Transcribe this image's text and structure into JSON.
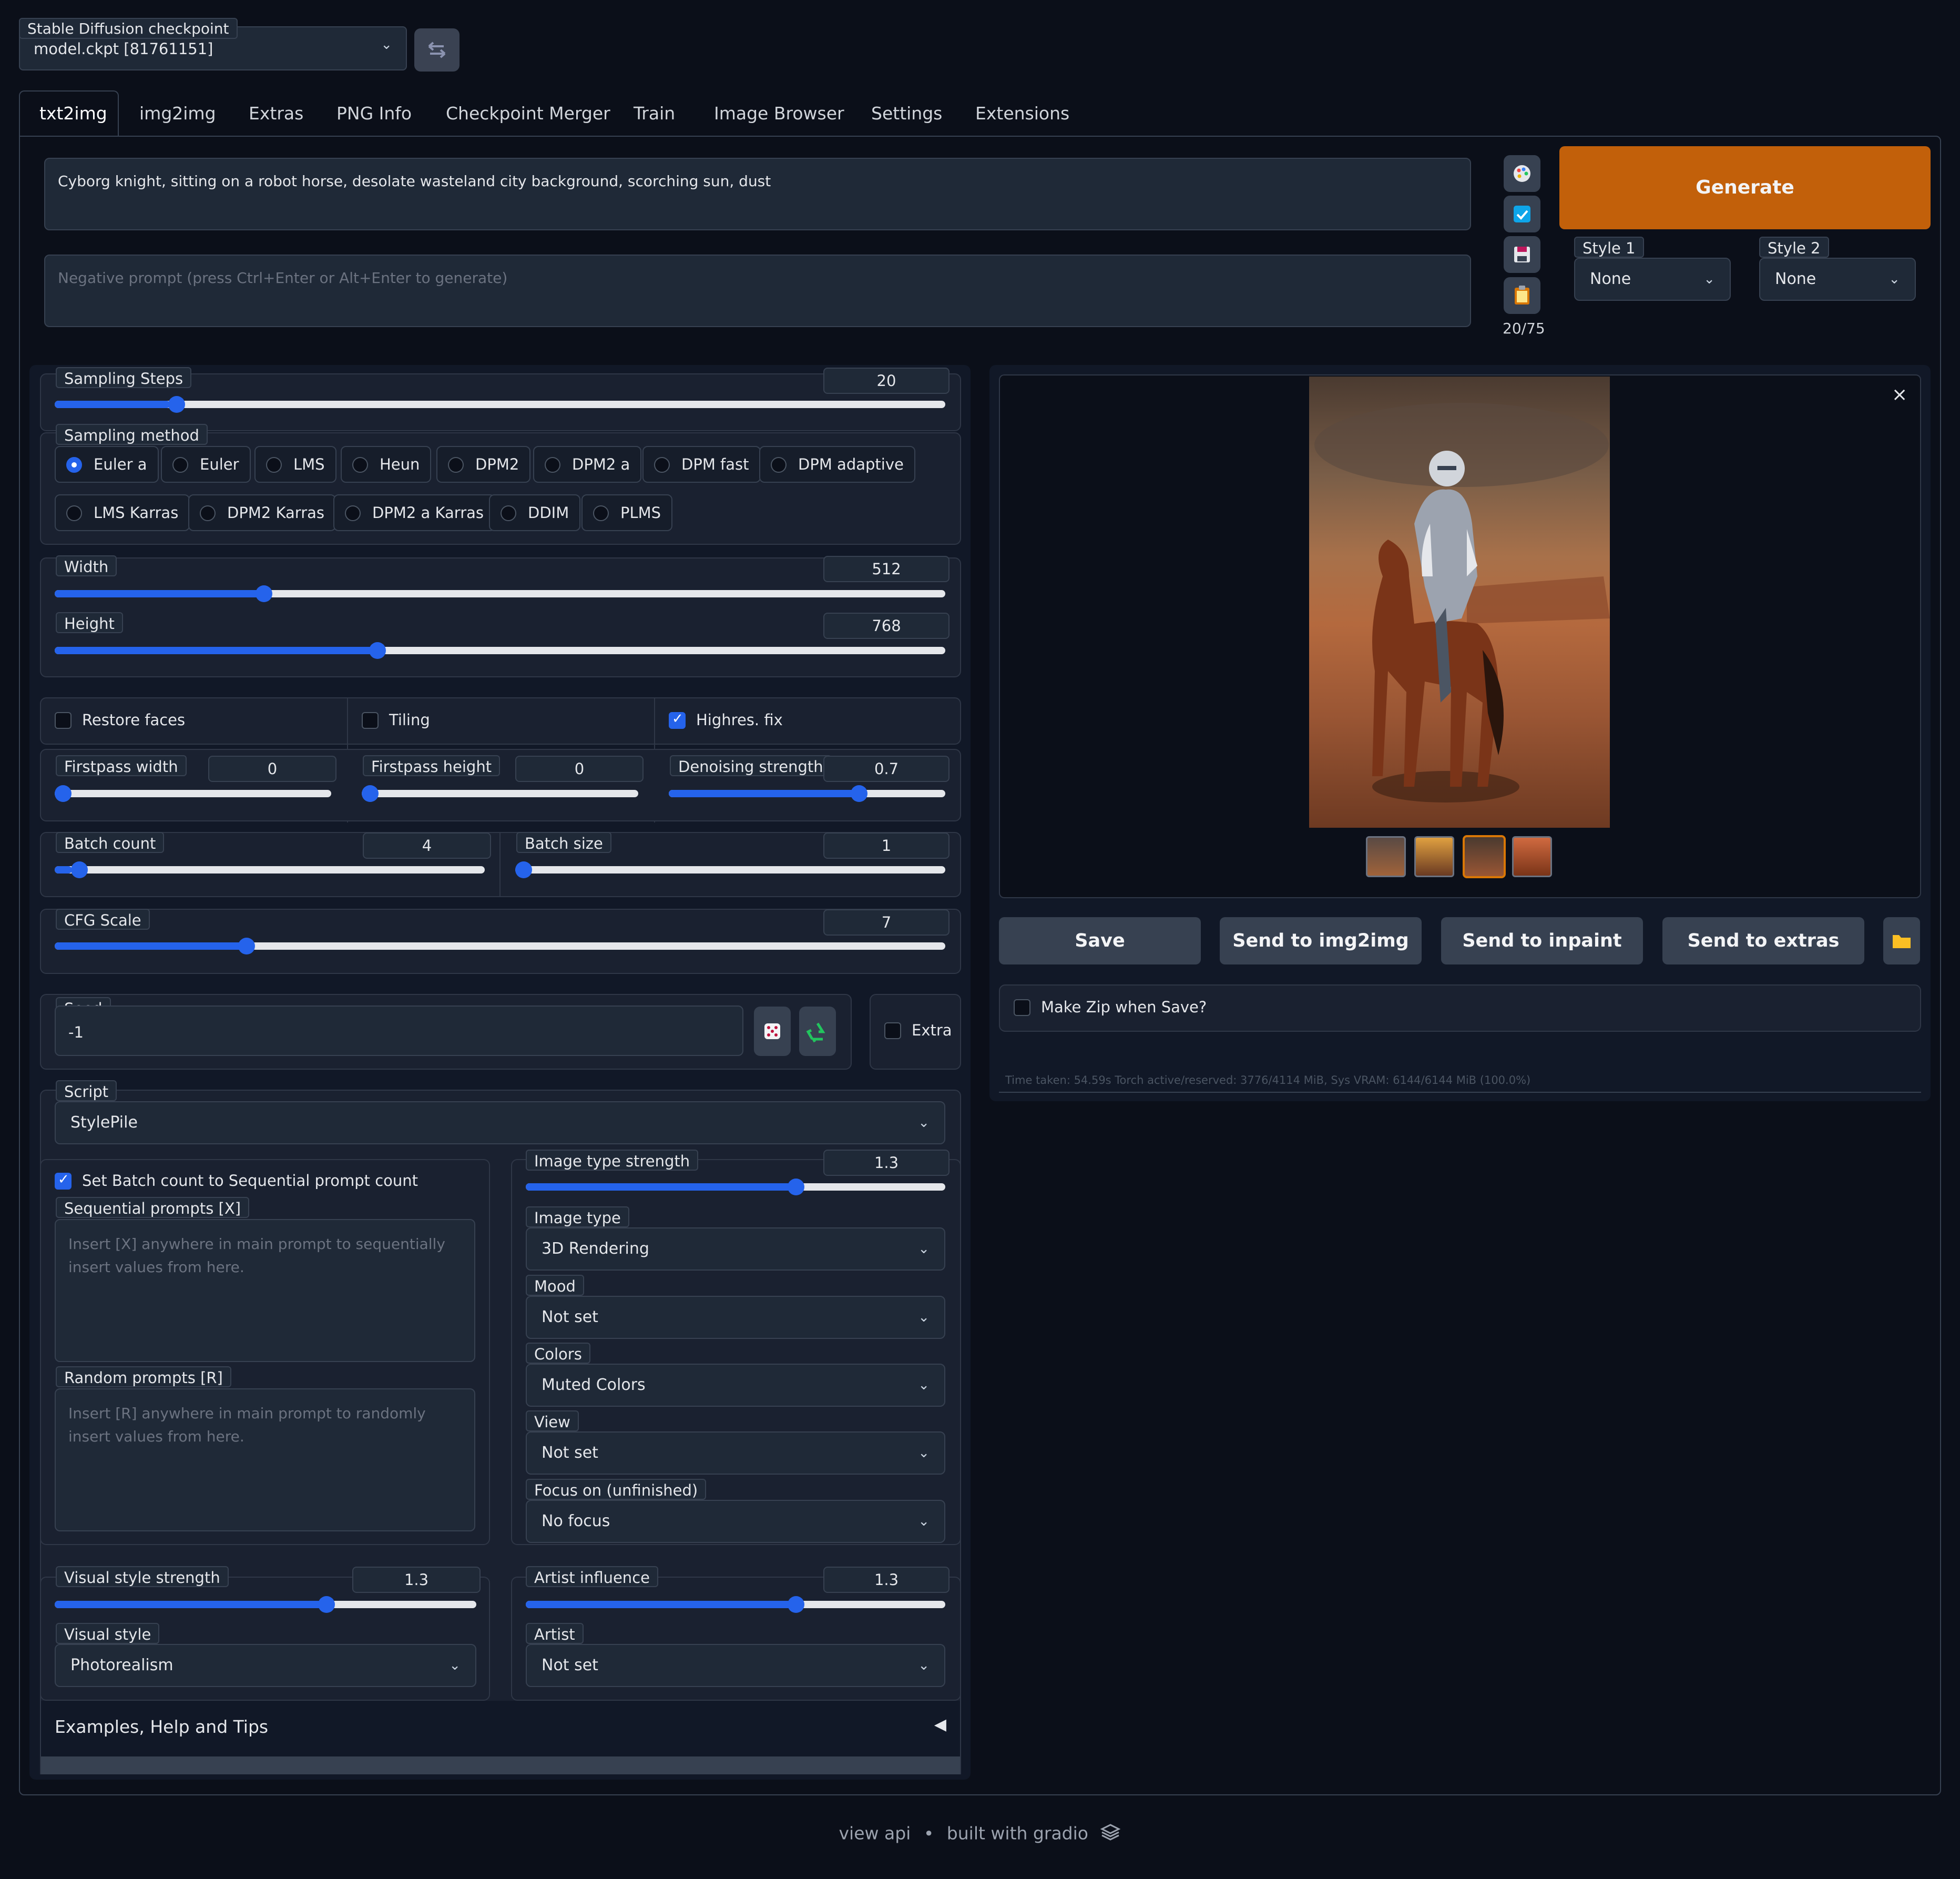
{
  "checkpoint": {
    "label": "Stable Diffusion checkpoint",
    "value": "model.ckpt [81761151]"
  },
  "tabs": [
    "txt2img",
    "img2img",
    "Extras",
    "PNG Info",
    "Checkpoint Merger",
    "Train",
    "Image Browser",
    "Settings",
    "Extensions"
  ],
  "prompt": {
    "value": "Cyborg knight, sitting on a robot horse, desolate wasteland city background, scorching sun, dust",
    "negative_placeholder": "Negative prompt (press Ctrl+Enter or Alt+Enter to generate)",
    "token_count": "20/75"
  },
  "generate": {
    "label": "Generate",
    "style1_label": "Style 1",
    "style1_value": "None",
    "style2_label": "Style 2",
    "style2_value": "None"
  },
  "sampling_steps": {
    "label": "Sampling Steps",
    "value": "20",
    "fraction": 0.13
  },
  "sampling_method": {
    "label": "Sampling method",
    "options": [
      "Euler a",
      "Euler",
      "LMS",
      "Heun",
      "DPM2",
      "DPM2 a",
      "DPM fast",
      "DPM adaptive",
      "LMS Karras",
      "DPM2 Karras",
      "DPM2 a Karras",
      "DDIM",
      "PLMS"
    ],
    "selected": "Euler a"
  },
  "width": {
    "label": "Width",
    "value": "512",
    "fraction": 0.23
  },
  "height": {
    "label": "Height",
    "value": "768",
    "fraction": 0.36
  },
  "options": {
    "restore_faces": "Restore faces",
    "tiling": "Tiling",
    "highres_fix": "Highres. fix"
  },
  "firstpass_width": {
    "label": "Firstpass width",
    "value": "0",
    "fraction": 0
  },
  "firstpass_height": {
    "label": "Firstpass height",
    "value": "0",
    "fraction": 0
  },
  "denoising": {
    "label": "Denoising strength",
    "value": "0.7",
    "fraction": 0.7
  },
  "batch_count": {
    "label": "Batch count",
    "value": "4",
    "fraction": 0.04
  },
  "batch_size": {
    "label": "Batch size",
    "value": "1",
    "fraction": 0
  },
  "cfg_scale": {
    "label": "CFG Scale",
    "value": "7",
    "fraction": 0.21
  },
  "seed": {
    "label": "Seed",
    "value": "-1",
    "extra_label": "Extra"
  },
  "script": {
    "label": "Script",
    "value": "StylePile"
  },
  "stylepile": {
    "set_batch_label": "Set Batch count to Sequential prompt count",
    "sequential_label": "Sequential prompts [X]",
    "sequential_placeholder": "Insert [X] anywhere in main prompt to sequentially insert values from here.",
    "random_label": "Random prompts [R]",
    "random_placeholder": "Insert [R] anywhere in main prompt to randomly insert values from here.",
    "image_type_strength": {
      "label": "Image type strength",
      "value": "1.3",
      "fraction": 0.65
    },
    "image_type": {
      "label": "Image type",
      "value": "3D Rendering"
    },
    "mood": {
      "label": "Mood",
      "value": "Not set"
    },
    "colors": {
      "label": "Colors",
      "value": "Muted Colors"
    },
    "view": {
      "label": "View",
      "value": "Not set"
    },
    "focus": {
      "label": "Focus on (unfinished)",
      "value": "No focus"
    },
    "visual_style_strength": {
      "label": "Visual style strength",
      "value": "1.3",
      "fraction": 0.65
    },
    "visual_style": {
      "label": "Visual style",
      "value": "Photorealism"
    },
    "artist_influence": {
      "label": "Artist influence",
      "value": "1.3",
      "fraction": 0.65
    },
    "artist": {
      "label": "Artist",
      "value": "Not set"
    }
  },
  "examples": {
    "label": "Examples, Help and Tips"
  },
  "output": {
    "buttons": [
      "Save",
      "Send to img2img",
      "Send to inpaint",
      "Send to extras"
    ],
    "make_zip": "Make Zip when Save?",
    "status": "Time taken: 54.59s  Torch active/reserved: 3776/4114 MiB, Sys VRAM: 6144/6144 MiB (100.0%)"
  },
  "footer": {
    "view_api": "view api",
    "separator": "•",
    "built_with": "built with gradio"
  },
  "colors": {
    "accent": "#2563eb",
    "generate": "#c2600a",
    "background": "#0b0f19"
  }
}
